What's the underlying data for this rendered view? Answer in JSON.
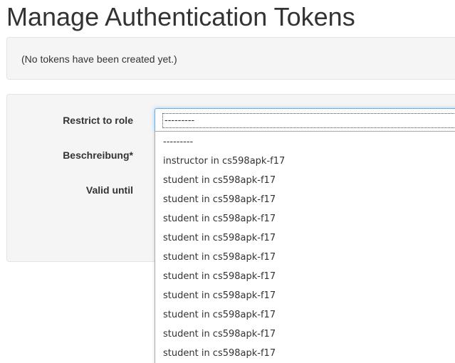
{
  "page": {
    "title": "Manage Authentication Tokens",
    "empty_message": "(No tokens have been created yet.)"
  },
  "form": {
    "labels": {
      "role": "Restrict to role",
      "description": "Beschreibung*",
      "valid_until": "Valid until"
    },
    "role_select": {
      "selected": "---------",
      "options": [
        "---------",
        "instructor in cs598apk-f17",
        "student in cs598apk-f17",
        "student in cs598apk-f17",
        "student in cs598apk-f17",
        "student in cs598apk-f17",
        "student in cs598apk-f17",
        "student in cs598apk-f17",
        "student in cs598apk-f17",
        "student in cs598apk-f17",
        "student in cs598apk-f17",
        "student in cs598apk-f17"
      ]
    }
  },
  "colors": {
    "focus_border": "#66afe9",
    "well_background": "#f5f5f5",
    "text": "#333333"
  }
}
